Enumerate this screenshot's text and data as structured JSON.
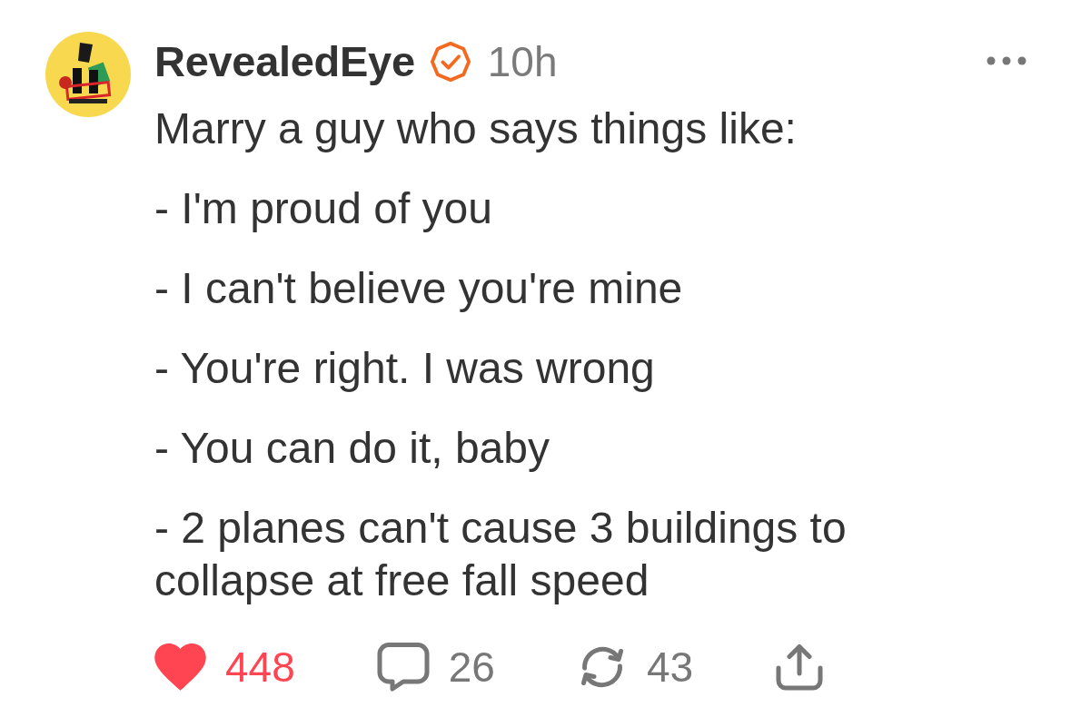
{
  "post": {
    "author": {
      "name": "RevealedEye",
      "verified": true
    },
    "time": "10h",
    "paragraphs": [
      "Marry a guy who says things like:",
      "- I'm proud of you",
      "- I can't believe you're mine",
      "- You're right. I was wrong",
      "- You can do it, baby",
      "- 2 planes can't cause 3 buildings to collapse at free fall speed"
    ],
    "liked": true,
    "actions": [
      {
        "kind": "like",
        "count": "448"
      },
      {
        "kind": "comment",
        "count": "26"
      },
      {
        "kind": "repost",
        "count": "43"
      },
      {
        "kind": "share"
      }
    ]
  }
}
